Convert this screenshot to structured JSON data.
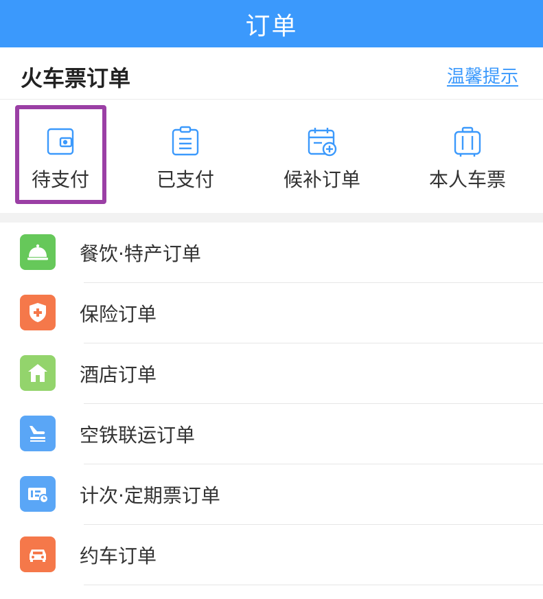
{
  "header": {
    "title": "订单"
  },
  "train_section": {
    "title": "火车票订单",
    "tips_link": "温馨提示"
  },
  "quick_actions": [
    {
      "label": "待支付",
      "icon": "wallet-icon",
      "highlighted": true
    },
    {
      "label": "已支付",
      "icon": "clipboard-icon"
    },
    {
      "label": "候补订单",
      "icon": "calendar-add-icon"
    },
    {
      "label": "本人车票",
      "icon": "suitcase-icon"
    }
  ],
  "orders": [
    {
      "label": "餐饮·特产订单",
      "icon": "service-bell-icon",
      "color": "#66c85a"
    },
    {
      "label": "保险订单",
      "icon": "shield-plus-icon",
      "color": "#f5784a"
    },
    {
      "label": "酒店订单",
      "icon": "hotel-icon",
      "color": "#93d46c"
    },
    {
      "label": "空铁联运订单",
      "icon": "plane-train-icon",
      "color": "#5aa6f6"
    },
    {
      "label": "计次·定期票订单",
      "icon": "ticket-clock-icon",
      "color": "#5aa6f6"
    },
    {
      "label": "约车订单",
      "icon": "car-icon",
      "color": "#f5784a"
    }
  ],
  "colors": {
    "primary": "#3b99fc",
    "highlight": "#9b3fa5"
  }
}
